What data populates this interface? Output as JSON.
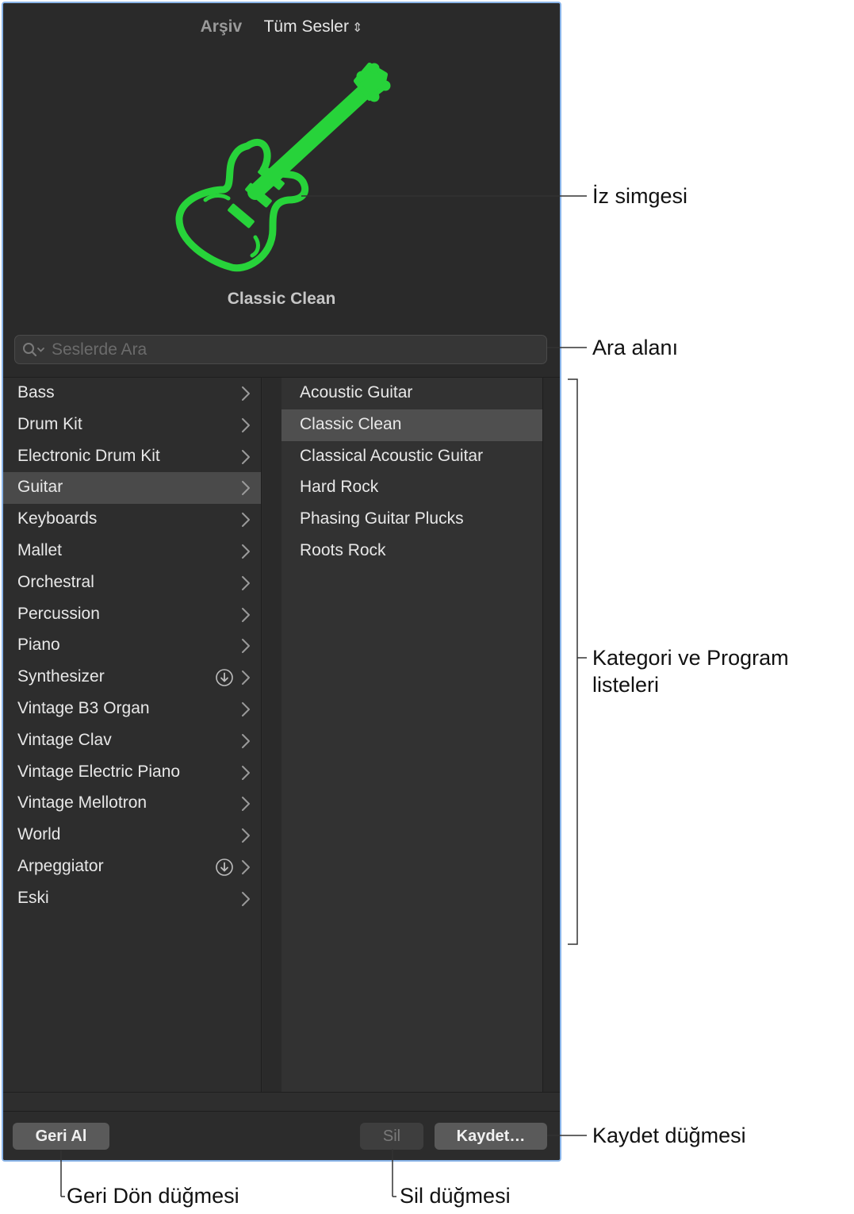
{
  "header": {
    "archive_tab": "Arşiv",
    "all_sounds": "Tüm Sesler",
    "updown_glyph": "⌃⌄",
    "patch_name": "Classic Clean"
  },
  "search": {
    "placeholder": "Seslerde Ara"
  },
  "categories": [
    {
      "label": "Bass",
      "download": false,
      "selected": false
    },
    {
      "label": "Drum Kit",
      "download": false,
      "selected": false
    },
    {
      "label": "Electronic Drum Kit",
      "download": false,
      "selected": false
    },
    {
      "label": "Guitar",
      "download": false,
      "selected": true
    },
    {
      "label": "Keyboards",
      "download": false,
      "selected": false
    },
    {
      "label": "Mallet",
      "download": false,
      "selected": false
    },
    {
      "label": "Orchestral",
      "download": false,
      "selected": false
    },
    {
      "label": "Percussion",
      "download": false,
      "selected": false
    },
    {
      "label": "Piano",
      "download": false,
      "selected": false
    },
    {
      "label": "Synthesizer",
      "download": true,
      "selected": false
    },
    {
      "label": "Vintage B3 Organ",
      "download": false,
      "selected": false
    },
    {
      "label": "Vintage Clav",
      "download": false,
      "selected": false
    },
    {
      "label": "Vintage Electric Piano",
      "download": false,
      "selected": false
    },
    {
      "label": "Vintage Mellotron",
      "download": false,
      "selected": false
    },
    {
      "label": "World",
      "download": false,
      "selected": false
    },
    {
      "label": "Arpeggiator",
      "download": true,
      "selected": false
    },
    {
      "label": "Eski",
      "download": false,
      "selected": false
    }
  ],
  "programs": [
    {
      "label": "Acoustic Guitar",
      "selected": false
    },
    {
      "label": "Classic Clean",
      "selected": true
    },
    {
      "label": "Classical Acoustic Guitar",
      "selected": false
    },
    {
      "label": "Hard Rock",
      "selected": false
    },
    {
      "label": "Phasing Guitar Plucks",
      "selected": false
    },
    {
      "label": "Roots Rock",
      "selected": false
    }
  ],
  "footer": {
    "revert_label": "Geri Al",
    "delete_label": "Sil",
    "save_label": "Kaydet…"
  },
  "callouts": {
    "track_icon": "İz simgesi",
    "search_field": "Ara alanı",
    "lists_line1": "Kategori ve Program",
    "lists_line2": "listeleri",
    "save_button": "Kaydet düğmesi",
    "revert_button": "Geri Dön düğmesi",
    "delete_button": "Sil düğmesi"
  },
  "colors": {
    "icon_green": "#27d33a",
    "panel_bg": "#2c2c2c",
    "selection": "#4a4a4a",
    "window_border": "#8ab4e8"
  }
}
